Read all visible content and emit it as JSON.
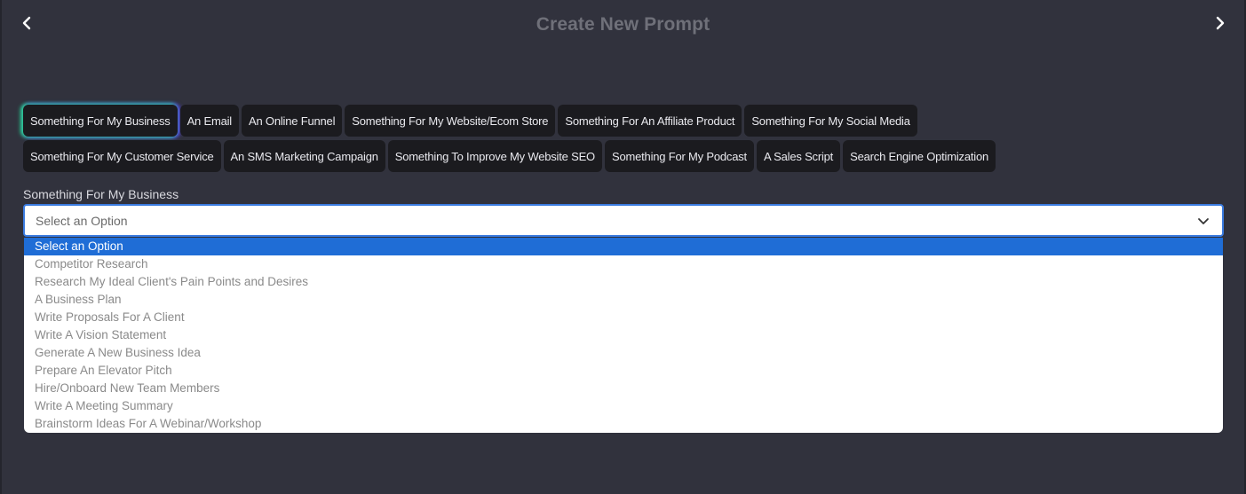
{
  "header": {
    "title": "Create New Prompt",
    "prev_icon": "chevron-left-icon",
    "next_icon": "chevron-right-icon"
  },
  "categories": [
    {
      "label": "Something For My Business",
      "active": true
    },
    {
      "label": "An Email"
    },
    {
      "label": "An Online Funnel"
    },
    {
      "label": "Something For My Website/Ecom Store"
    },
    {
      "label": "Something For An Affiliate Product"
    },
    {
      "label": "Something For My Social Media"
    },
    {
      "label": "Something For My Customer Service"
    },
    {
      "label": "An SMS Marketing Campaign"
    },
    {
      "label": "Something To Improve My Website SEO"
    },
    {
      "label": "Something For My Podcast"
    },
    {
      "label": "A Sales Script"
    },
    {
      "label": "Search Engine Optimization"
    }
  ],
  "field": {
    "label": "Something For My Business",
    "value": "Select an Option",
    "caret_icon": "chevron-down-icon"
  },
  "dropdown": {
    "options": [
      "Select an Option",
      "Competitor Research",
      "Research My Ideal Client's Pain Points and Desires",
      "A Business Plan",
      "Write Proposals For A Client",
      "Write A Vision Statement",
      "Generate A New Business Idea",
      "Prepare An Elevator Pitch",
      "Hire/Onboard New Team Members",
      "Write A Meeting Summary",
      "Brainstorm Ideas For A Webinar/Workshop"
    ],
    "selected_index": 0
  },
  "colors": {
    "background": "#31323d",
    "chip": "#1b1b1f",
    "highlight": "#1f6dd6",
    "focus_border": "#3a7be0"
  }
}
